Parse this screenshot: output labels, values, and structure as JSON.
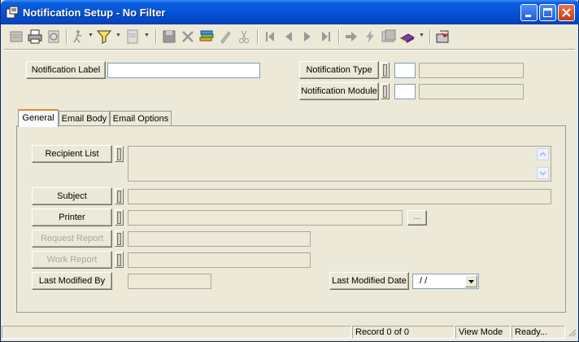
{
  "window": {
    "title": "Notification Setup - No Filter"
  },
  "header": {
    "notification_label_button": "Notification Label",
    "notification_label_value": "",
    "notification_type_button": "Notification Type",
    "notification_module_button": "Notification Module"
  },
  "tabs": [
    {
      "label": "General",
      "active": true
    },
    {
      "label": "Email Body",
      "active": false
    },
    {
      "label": "Email Options",
      "active": false
    }
  ],
  "general": {
    "recipient_list_button": "Recipient List",
    "subject_button": "Subject",
    "printer_button": "Printer",
    "printer_browse": "...",
    "request_report_button": "Request Report",
    "work_report_button": "Work Report",
    "last_modified_by_button": "Last Modified By",
    "last_modified_date_button": "Last Modified Date",
    "last_modified_date_value": "/ /"
  },
  "status": {
    "record": "Record 0 of 0",
    "mode": "View Mode",
    "state": "Ready..."
  },
  "colors": {
    "titlebar": "#0553d8",
    "window_bg": "#ece9d8",
    "tab_accent": "#e68b2c"
  }
}
